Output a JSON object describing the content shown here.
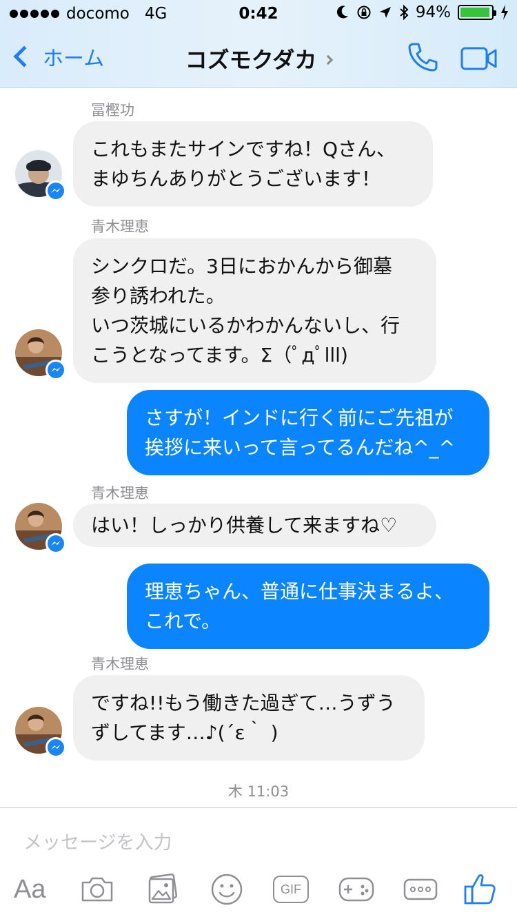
{
  "status_bar": {
    "carrier": "docomo",
    "network": "4G",
    "time": "0:42",
    "battery": "94%",
    "battery_fraction": 0.94
  },
  "nav": {
    "back_label": "ホーム",
    "title": "コズモクダカ"
  },
  "messages": [
    {
      "sender": "冨樫功",
      "direction": "in",
      "lines": [
        "これもまたサインですね！Qさん、",
        "まゆちんありがとうございます！"
      ]
    },
    {
      "sender": "青木理恵",
      "direction": "in",
      "lines": [
        "シンクロだ。3日におかんから御墓",
        "参り誘われた。",
        "いつ茨城にいるかわかんないし、行",
        "こうとなってます。Σ（ﾟдﾟlll)"
      ]
    },
    {
      "direction": "out",
      "lines": [
        "さすが！インドに行く前にご先祖が",
        "挨拶に来いって言ってるんだね^_^"
      ]
    },
    {
      "sender": "青木理恵",
      "direction": "in",
      "lines": [
        "はい！しっかり供養して来ますね♡"
      ]
    },
    {
      "direction": "out",
      "lines": [
        "理恵ちゃん、普通に仕事決まるよ、",
        "これで。"
      ]
    },
    {
      "sender": "青木理恵",
      "direction": "in",
      "lines": [
        "ですね!!もう働きた過ぎて…うずう",
        "ずしてます…♪(´ε｀ )"
      ]
    }
  ],
  "timestamp": "木 11:03",
  "composer": {
    "placeholder": "メッセージを入力",
    "aa_label": "Aa",
    "gif_label": "GIF"
  },
  "colors": {
    "accent": "#1f7ef2",
    "outgoing_bubble": "#0b84ff",
    "incoming_bubble": "#f1f0f0"
  }
}
